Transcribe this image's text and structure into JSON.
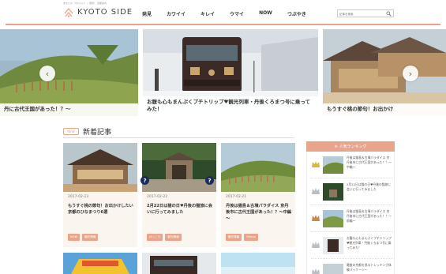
{
  "header": {
    "tagline": "あなたの「かわいい！」発見！ 京都案内",
    "logo_text": "KYOTO SIDE",
    "nav": [
      "発見",
      "カワイイ",
      "キレイ",
      "ウマイ",
      "NOW",
      "つぶやき"
    ],
    "search_placeholder": "記事を検索"
  },
  "slider": {
    "prev_glyph": "‹",
    "next_glyph": "›",
    "slides": [
      {
        "caption": "丹に古代王国があった！？～"
      },
      {
        "caption": "お腹も心もまんぷくプチトリップ♥観光列車・丹後くろまつ号に乗ってみた！"
      },
      {
        "caption": "もうすぐ桃の節句！お出かけ"
      }
    ]
  },
  "new_articles": {
    "badge": "NEW",
    "title": "新着記事",
    "cards": [
      {
        "date": "2017-02-23",
        "title": "もうすぐ桃の節句！お出かけしたい京都のひなまつり6選",
        "tags": [
          "NOW",
          "観光情報"
        ]
      },
      {
        "date": "2017-02-22",
        "title": "2月22日は猫の日♥丹後の猫旅に会いに行ってみました",
        "tags": [
          "ほっこり",
          "観光情報"
        ]
      },
      {
        "date": "2017-02-21",
        "title": "丹後は猫島＆古墳パラダイス 京丹後市に古代王国があった！？～中編～",
        "tags": [
          "観光情報",
          "Pickup"
        ]
      }
    ]
  },
  "ranking": {
    "title": "♔ 人気ランキング",
    "items": [
      {
        "text": "丹後は猫島＆古墳パラダイス 京丹後市に古代王国があった！？～中編～"
      },
      {
        "text": "2月22日は猫の日♥丹後の猫旅に会いに行ってみました"
      },
      {
        "text": "丹後は猫島＆古墳パラダイス 京丹後市に古代王国があった！？～前編～"
      },
      {
        "text": "お腹も心もまんぷくプチトリップ♥観光列車・丹後くろまつ号に乗ってみた！"
      },
      {
        "text": "最後の京都を巡るトレッキング体験パッケージ～"
      }
    ]
  },
  "colors": {
    "accent": "#e9a58c",
    "rule": "#e7a488",
    "card_bg": "#fbf5ef"
  },
  "icons": [
    "logo-mark-icon",
    "search-icon",
    "chevron-left-icon",
    "chevron-right-icon",
    "crown-icon"
  ]
}
